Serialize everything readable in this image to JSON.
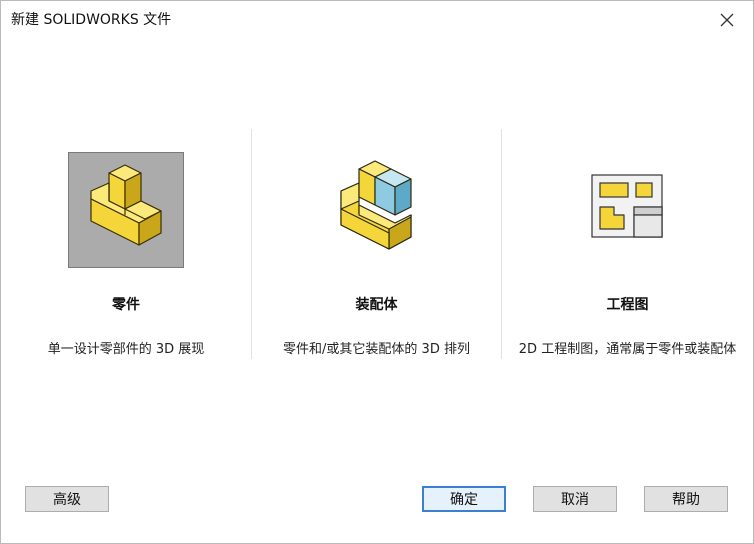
{
  "window": {
    "title": "新建 SOLIDWORKS 文件",
    "close_icon": "close-icon"
  },
  "options": [
    {
      "id": "part",
      "label": "零件",
      "description": "单一设计零部件的 3D 展现",
      "icon": "part-icon",
      "selected": true
    },
    {
      "id": "assembly",
      "label": "装配体",
      "description": "零件和/或其它装配体的 3D 排列",
      "icon": "assembly-icon",
      "selected": false
    },
    {
      "id": "drawing",
      "label": "工程图",
      "description": "2D 工程制图，通常属于零件或装配体",
      "icon": "drawing-icon",
      "selected": false
    }
  ],
  "buttons": {
    "advanced": "高级",
    "ok": "确定",
    "cancel": "取消",
    "help": "帮助"
  },
  "colors": {
    "part_yellow": "#f5d63a",
    "assembly_blue": "#8ecbe3",
    "selection_gray": "#ababab",
    "default_button_border": "#3b7fd1"
  }
}
